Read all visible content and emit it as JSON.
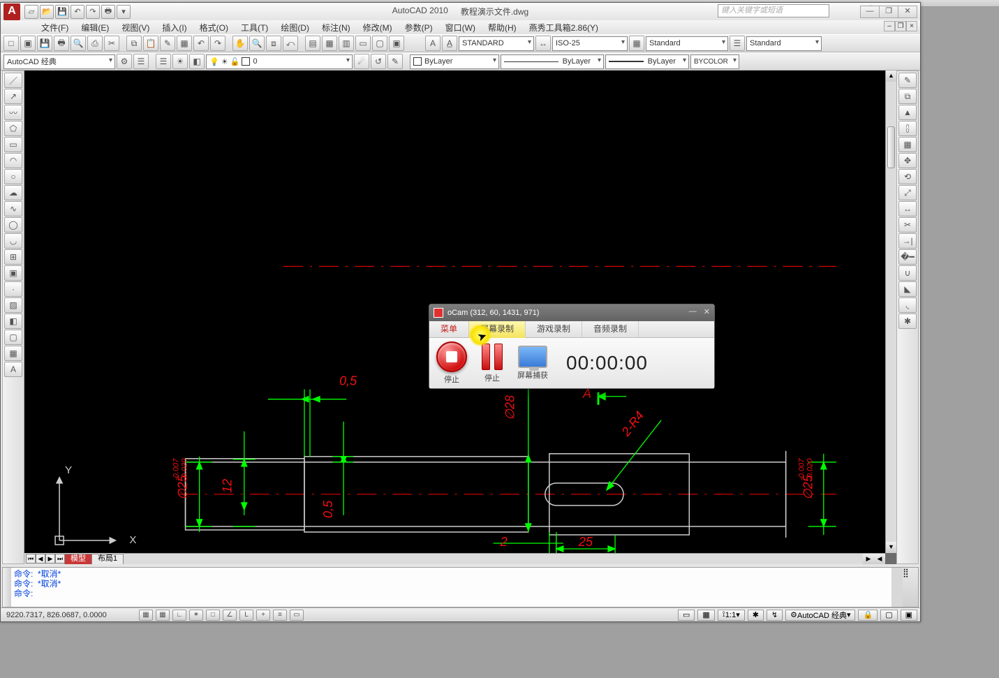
{
  "title": {
    "app": "AutoCAD 2010",
    "doc": "教程演示文件.dwg",
    "search_placeholder": "键入关键字或短语"
  },
  "menu": [
    "文件(F)",
    "编辑(E)",
    "视图(V)",
    "插入(I)",
    "格式(O)",
    "工具(T)",
    "绘图(D)",
    "标注(N)",
    "修改(M)",
    "参数(P)",
    "窗口(W)",
    "帮助(H)",
    "燕秀工具箱2.86(Y)"
  ],
  "row1": {
    "text_style": "STANDARD",
    "dim_style": "ISO-25",
    "table_style": "Standard",
    "ml_style": "Standard"
  },
  "row2": {
    "workspace": "AutoCAD 经典",
    "layer": "0",
    "color": "ByLayer",
    "linetype": "ByLayer",
    "lineweight": "ByLayer",
    "plotstyle": "BYCOLOR"
  },
  "tabs": {
    "model": "模型",
    "layout1": "布局1"
  },
  "cmd": {
    "l1": "命令:  *取消*",
    "l2": "命令:  *取消*",
    "l3": "命令:"
  },
  "status": {
    "coords": "9220.7317, 826.0687, 0.0000",
    "scale": "1:1",
    "ws": "AutoCAD 经典"
  },
  "drawing": {
    "axisX": "X",
    "axisY": "Y",
    "d1": "0,5",
    "d2": "0,5",
    "d3": "12",
    "d4": "∅28",
    "d5": "A",
    "d6": "2-R4",
    "d7": "2",
    "d8": "25",
    "tol1a": "-0.007",
    "tol1b": "-0.020",
    "tol1base": "∅25",
    "tol2a": "-0.007",
    "tol2b": "-0.020",
    "tol2base": "∅25"
  },
  "ocam": {
    "title": "oCam (312, 60, 1431, 971)",
    "menu": "菜单",
    "tab_rec": "屏幕录制",
    "tab_game": "游戏录制",
    "tab_audio": "音频录制",
    "stop": "停止",
    "pause": "停止",
    "capture": "屏幕捕获",
    "time": "00:00:00"
  }
}
